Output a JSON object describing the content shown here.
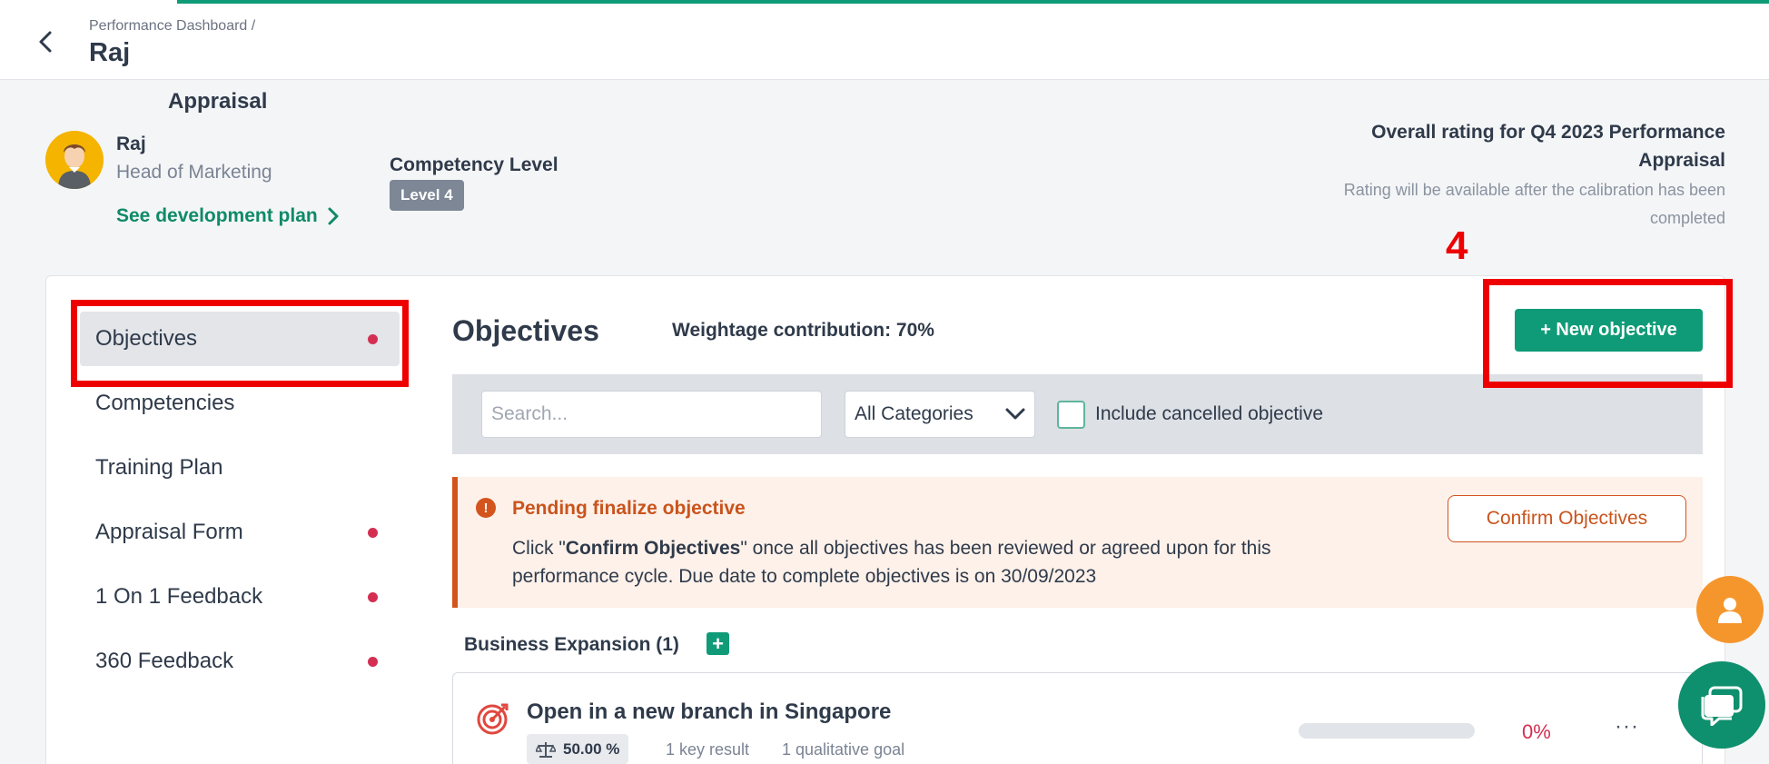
{
  "colors": {
    "brand_green": "#0f9b77",
    "alert_orange": "#d4541e",
    "status_red": "#d42f52",
    "annotation_red": "#ee0000",
    "fab_orange": "#f5962d"
  },
  "header": {
    "breadcrumb": "Performance Dashboard  /",
    "title": "Raj",
    "back_icon": "chevron-left-icon"
  },
  "profile": {
    "section_title": "Appraisal",
    "name": "Raj",
    "role": "Head of Marketing",
    "dev_plan_link": "See development plan",
    "competency_label": "Competency Level",
    "competency_level": "Level 4",
    "overall_title": "Overall rating for Q4 2023 Performance Appraisal",
    "overall_sub": "Rating will be available after the calibration has been completed"
  },
  "annotation": {
    "step_number": "4"
  },
  "sidebar": {
    "items": [
      {
        "label": "Objectives",
        "active": true,
        "dot": true
      },
      {
        "label": "Competencies",
        "active": false,
        "dot": false
      },
      {
        "label": "Training Plan",
        "active": false,
        "dot": false
      },
      {
        "label": "Appraisal Form",
        "active": false,
        "dot": true
      },
      {
        "label": "1 On 1 Feedback",
        "active": false,
        "dot": true
      },
      {
        "label": "360 Feedback",
        "active": false,
        "dot": true
      }
    ]
  },
  "main": {
    "title": "Objectives",
    "weightage": "Weightage contribution: 70%",
    "new_objective_button": "+ New objective",
    "filters": {
      "search_placeholder": "Search...",
      "search_value": "",
      "category_selected": "All Categories",
      "include_cancelled_label": "Include cancelled objective",
      "include_cancelled_checked": false
    },
    "alert": {
      "title": "Pending finalize objective",
      "text_prefix": "Click \"",
      "text_bold": "Confirm Objectives",
      "text_suffix": "\" once all objectives has been reviewed or agreed upon for this performance cycle. Due date to complete objectives is on 30/09/2023",
      "button": "Confirm Objectives"
    },
    "group": {
      "label": "Business Expansion (1)"
    },
    "objectives": [
      {
        "name": "Open in a new branch in Singapore",
        "weight": "50.00 %",
        "key_results": "1 key result",
        "qualitative": "1 qualitative goal",
        "progress": 0,
        "progress_label": "0%",
        "more": "···"
      }
    ]
  }
}
